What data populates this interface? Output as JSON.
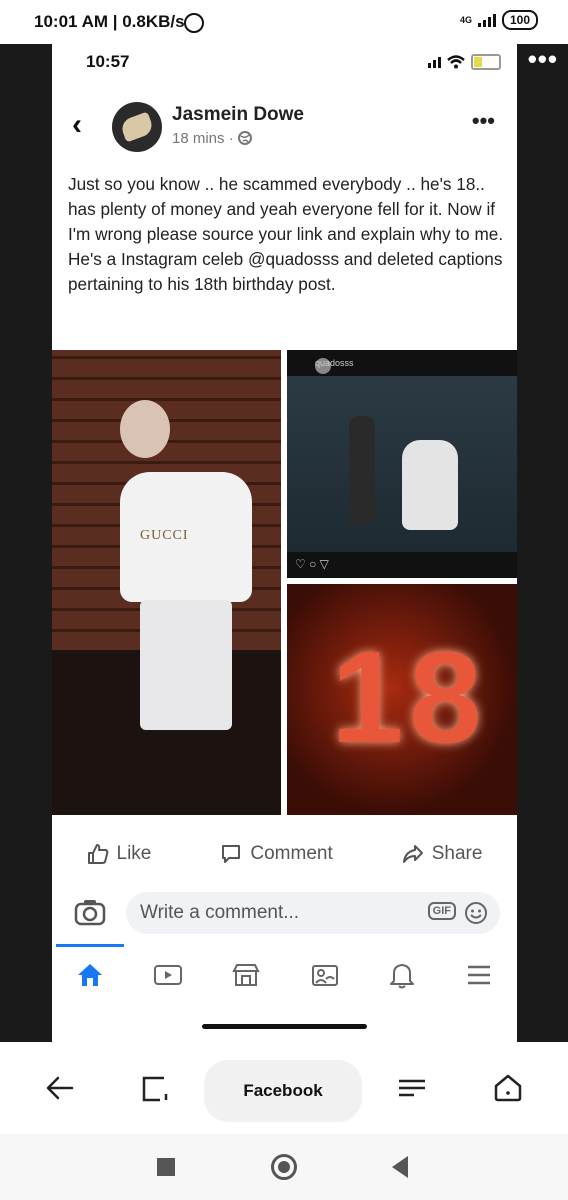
{
  "outer_status": {
    "time": "10:01 AM | 0.8KB/s",
    "network": "4G",
    "battery": "100"
  },
  "viewer": {
    "more": "•••"
  },
  "phone_status": {
    "time": "10:57"
  },
  "post": {
    "author": "Jasmein Dowe",
    "meta": "18 mins ·",
    "more": "•••",
    "caption": "Just so you know .. he scammed everybody .. he's 18.. has plenty of money and yeah everyone fell for it. Now if I'm wrong please source your link and explain why to me. He's a Instagram celeb @quadosss and deleted captions pertaining to his 18th birthday post.",
    "media": {
      "left_logo": "GUCCI",
      "ig_username": "quadosss",
      "number_sign": "18"
    }
  },
  "actions": {
    "like": "Like",
    "comment": "Comment",
    "share": "Share"
  },
  "comment_box": {
    "placeholder": "Write a comment...",
    "gif": "GIF"
  },
  "tabs": [
    "home-icon",
    "watch-icon",
    "marketplace-icon",
    "groups-icon",
    "notifications-icon",
    "menu-icon"
  ],
  "browser": {
    "title": "Facebook"
  },
  "colors": {
    "accent": "#1877f2"
  }
}
